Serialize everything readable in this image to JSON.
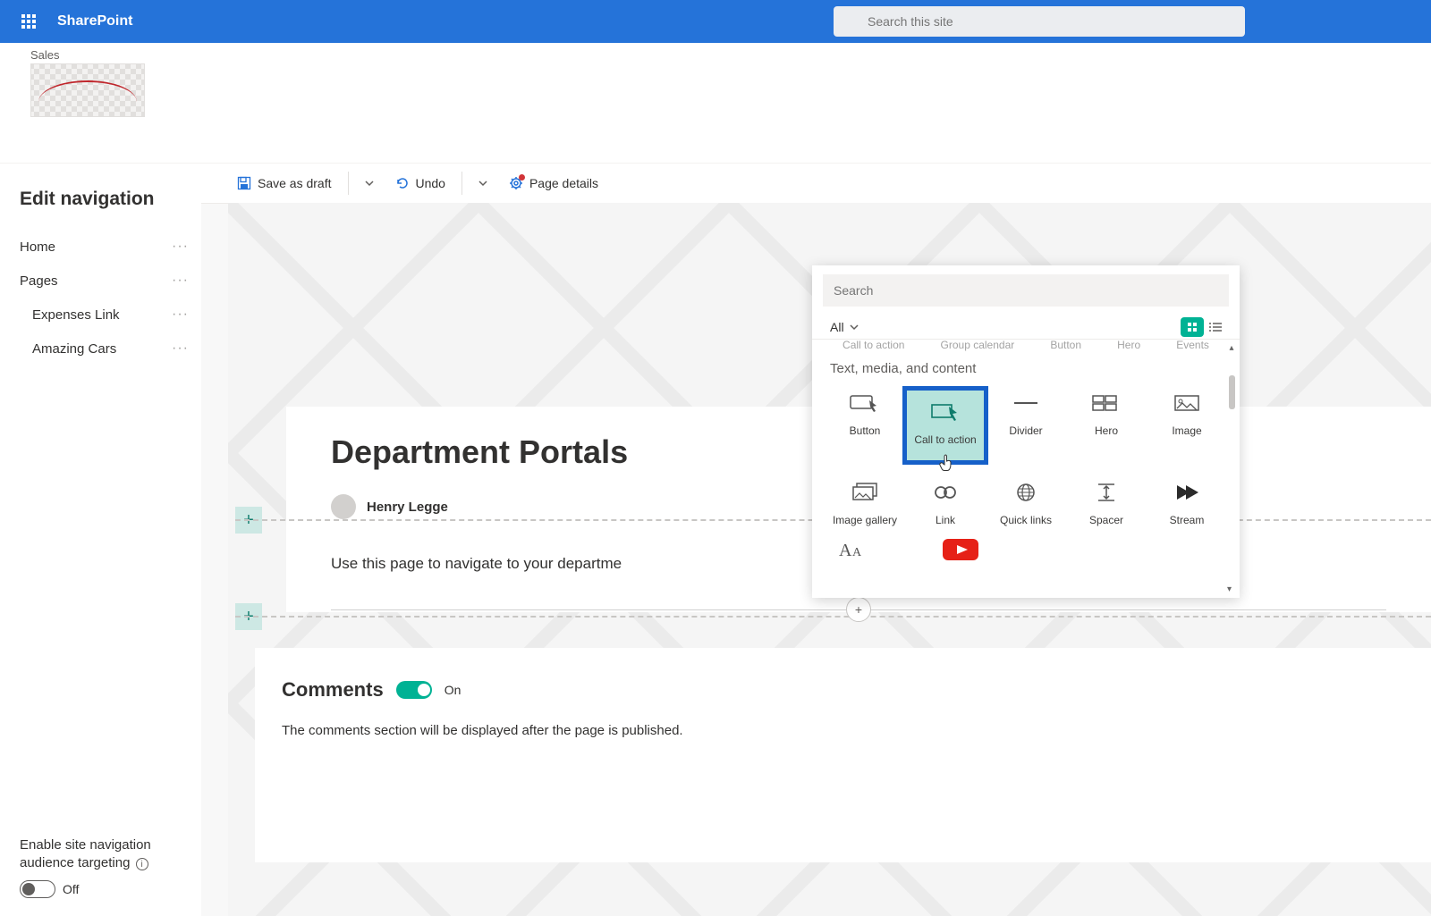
{
  "suite": {
    "brand": "SharePoint",
    "search_placeholder": "Search this site"
  },
  "site": {
    "name": "Sales"
  },
  "sidebar": {
    "title": "Edit navigation",
    "items": [
      {
        "label": "Home",
        "indent": false
      },
      {
        "label": "Pages",
        "indent": false
      },
      {
        "label": "Expenses Link",
        "indent": true
      },
      {
        "label": "Amazing Cars",
        "indent": true
      }
    ],
    "targeting_label1": "Enable site navigation",
    "targeting_label2": "audience targeting",
    "toggle_label": "Off"
  },
  "cmdbar": {
    "save": "Save as draft",
    "undo": "Undo",
    "details": "Page details"
  },
  "page": {
    "title": "Department Portals",
    "author": "Henry Legge",
    "body": "Use this page to navigate to your departme",
    "comments_title": "Comments",
    "comments_state": "On",
    "comments_note": "The comments section will be displayed after the page is published."
  },
  "picker": {
    "search_placeholder": "Search",
    "filter": "All",
    "peek": [
      "Call to action",
      "Group calendar",
      "Button",
      "Hero",
      "Events"
    ],
    "category": "Text, media, and content",
    "row1": [
      "Button",
      "Call to action",
      "Divider",
      "Hero",
      "Image"
    ],
    "row2": [
      "Image gallery",
      "Link",
      "Quick links",
      "Spacer",
      "Stream"
    ]
  }
}
